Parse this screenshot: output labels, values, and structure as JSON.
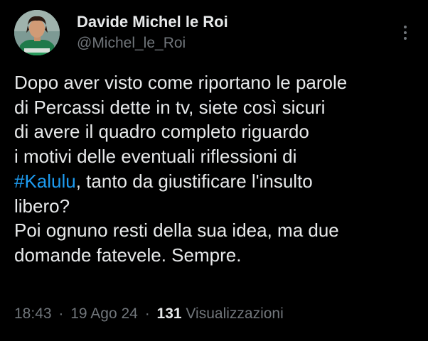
{
  "author": {
    "display_name": "Davide Michel le Roi",
    "handle": "@Michel_le_Roi",
    "avatar_icon": "profile-avatar"
  },
  "menu": {
    "icon": "more-options-icon"
  },
  "tweet": {
    "lines": [
      "Dopo aver visto come riportano le parole",
      "di Percassi dette in tv, siete così sicuri",
      "di avere il quadro completo riguardo",
      "i motivi delle eventuali riflessioni di",
      "libero?",
      "Poi ognuno resti della sua idea, ma due",
      "domande fatevele. Sempre."
    ],
    "hashtag": "#Kalulu",
    "hashtag_line_rest": ", tanto da giustificare l'insulto"
  },
  "meta": {
    "time": "18:43",
    "separator": "·",
    "date": "19 Ago 24",
    "views_count": "131",
    "views_label": "Visualizzazioni"
  },
  "colors": {
    "background": "#000000",
    "text": "#e7e9ea",
    "muted": "#71767b",
    "accent": "#1d9bf0"
  }
}
